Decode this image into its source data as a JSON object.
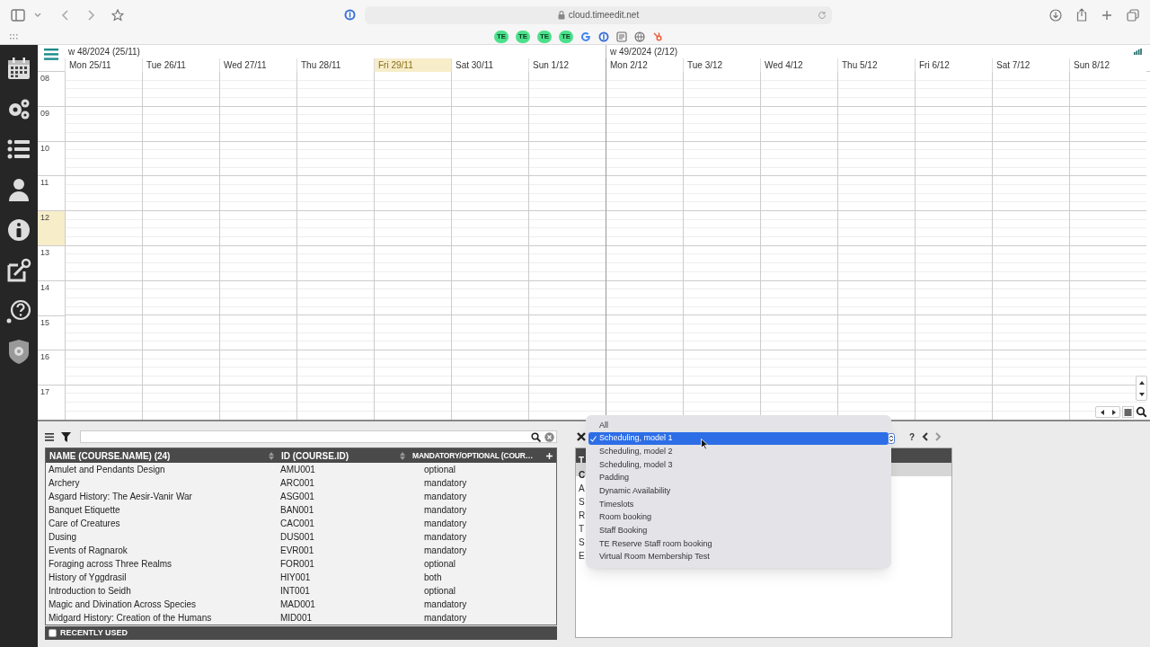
{
  "browser": {
    "url": "cloud.timeedit.net",
    "bookmarks": [
      "TE",
      "TE",
      "TE",
      "TE"
    ]
  },
  "calendar": {
    "weeks": [
      {
        "label": "w 48/2024 (25/11)",
        "days": [
          {
            "label": "Mon 25/11",
            "today": false
          },
          {
            "label": "Tue 26/11",
            "today": false
          },
          {
            "label": "Wed 27/11",
            "today": false
          },
          {
            "label": "Thu 28/11",
            "today": false
          },
          {
            "label": "Fri 29/11",
            "today": true
          },
          {
            "label": "Sat 30/11",
            "today": false
          },
          {
            "label": "Sun 1/12",
            "today": false
          }
        ]
      },
      {
        "label": "w 49/2024 (2/12)",
        "days": [
          {
            "label": "Mon 2/12",
            "today": false
          },
          {
            "label": "Tue 3/12",
            "today": false
          },
          {
            "label": "Wed 4/12",
            "today": false
          },
          {
            "label": "Thu 5/12",
            "today": false
          },
          {
            "label": "Fri 6/12",
            "today": false
          },
          {
            "label": "Sat 7/12",
            "today": false
          },
          {
            "label": "Sun 8/12",
            "today": false
          }
        ]
      }
    ],
    "hours": [
      {
        "label": "08",
        "current": false
      },
      {
        "label": "09",
        "current": false
      },
      {
        "label": "10",
        "current": false
      },
      {
        "label": "11",
        "current": false
      },
      {
        "label": "12",
        "current": true
      },
      {
        "label": "13",
        "current": false
      },
      {
        "label": "14",
        "current": false
      },
      {
        "label": "15",
        "current": false
      },
      {
        "label": "16",
        "current": false
      },
      {
        "label": "17",
        "current": false
      }
    ]
  },
  "course_list": {
    "columns": [
      "NAME (COURSE.NAME) (24)",
      "ID (COURSE.ID)",
      "MANDATORY/OPTIONAL (COUR…"
    ],
    "rows": [
      [
        "Amulet and Pendants Design",
        "AMU001",
        "optional"
      ],
      [
        "Archery",
        "ARC001",
        "mandatory"
      ],
      [
        "Asgard History: The Aesir-Vanir War",
        "ASG001",
        "mandatory"
      ],
      [
        "Banquet Etiquette",
        "BAN001",
        "mandatory"
      ],
      [
        "Care of Creatures",
        "CAC001",
        "mandatory"
      ],
      [
        "Dusing",
        "DUS001",
        "mandatory"
      ],
      [
        "Events of Ragnarok",
        "EVR001",
        "mandatory"
      ],
      [
        "Foraging across Three Realms",
        "FOR001",
        "optional"
      ],
      [
        "History of Yggdrasil",
        "HIY001",
        "both"
      ],
      [
        "Introduction to Seidh",
        "INT001",
        "optional"
      ],
      [
        "Magic and Divination Across Species",
        "MAD001",
        "mandatory"
      ],
      [
        "Midgard History: Creation of the Humans",
        "MID001",
        "mandatory"
      ]
    ],
    "recently_used": {
      "label": "RECENTLY USED",
      "checked": false
    }
  },
  "reservation_panel": {
    "help": "?",
    "header": "T",
    "rows": [
      "C",
      "A",
      "S",
      "R",
      "T",
      "S",
      "E"
    ]
  },
  "mode_dropdown": {
    "options": [
      {
        "label": "All",
        "selected": false
      },
      {
        "label": "Scheduling, model 1",
        "selected": true
      },
      {
        "label": "Scheduling, model 2",
        "selected": false
      },
      {
        "label": "Scheduling, model 3",
        "selected": false
      },
      {
        "label": "Padding",
        "selected": false
      },
      {
        "label": "Dynamic Availability",
        "selected": false
      },
      {
        "label": "Timeslots",
        "selected": false
      },
      {
        "label": "Room booking",
        "selected": false
      },
      {
        "label": "Staff Booking",
        "selected": false
      },
      {
        "label": "TE Reserve Staff room booking",
        "selected": false
      },
      {
        "label": "Virtual Room Membership Test",
        "selected": false
      }
    ]
  }
}
